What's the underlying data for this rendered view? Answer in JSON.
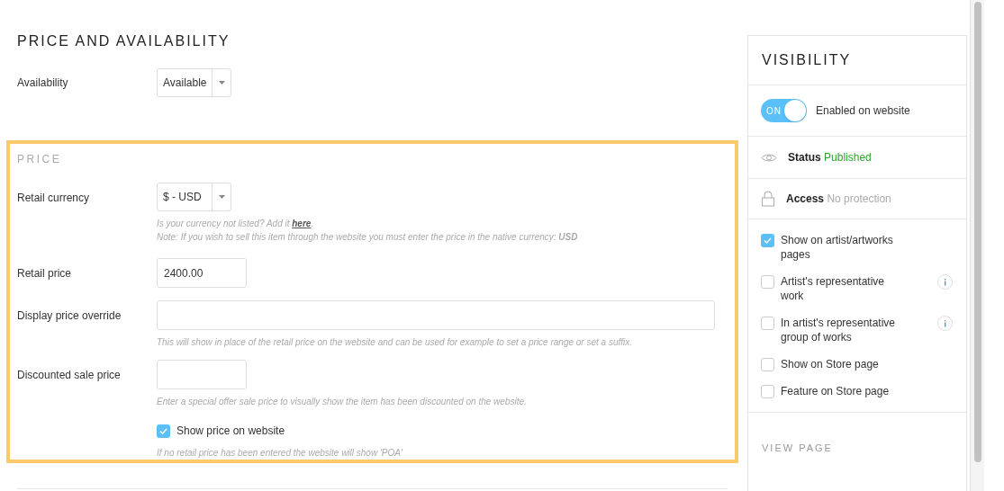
{
  "title": "PRICE AND AVAILABILITY",
  "availability": {
    "label": "Availability",
    "value": "Available"
  },
  "price": {
    "heading": "PRICE",
    "fields": [
      {
        "kind": "select",
        "label": "Retail currency",
        "value": "$ - USD",
        "hint_lines": [
          {
            "before": "Is your currency not listed? Add it ",
            "link": "here",
            "after": "."
          },
          {
            "text": "Note: If you wish to sell this item through the website you must enter the price in the native currency: **USD**"
          }
        ]
      },
      {
        "kind": "short_input",
        "label": "Retail price",
        "value": "2400.00"
      },
      {
        "kind": "wide_input",
        "label": "Display price override",
        "hint_lines": [
          {
            "text": "This will show in place of the retail price on the website and can be used for example to set a price range or set a suffix."
          }
        ]
      },
      {
        "kind": "short_input",
        "label": "Discounted sale price",
        "hint_lines": [
          {
            "text": "Enter a special offer sale price to visually show the item has been discounted on the website."
          }
        ]
      }
    ],
    "show_price": {
      "label": "Show price on website",
      "checked": true,
      "hint": "If no retail price has been entered the website will show 'POA'"
    }
  },
  "visibility": {
    "title": "VISIBILITY",
    "toggle": {
      "on": true,
      "text": "ON",
      "label": "Enabled on website"
    },
    "status": {
      "label": "Status",
      "value": "Published"
    },
    "access": {
      "label": "Access",
      "value": "No protection"
    },
    "options": [
      {
        "label": "Show on artist/artworks pages",
        "checked": true,
        "info": false
      },
      {
        "label": "Artist's representative work",
        "checked": false,
        "info": true
      },
      {
        "label": "In artist's representative group of works",
        "checked": false,
        "info": true
      },
      {
        "label": "Show on Store page",
        "checked": false,
        "info": false
      },
      {
        "label": "Feature on Store page",
        "checked": false,
        "info": false
      }
    ],
    "view_page": "VIEW PAGE"
  }
}
